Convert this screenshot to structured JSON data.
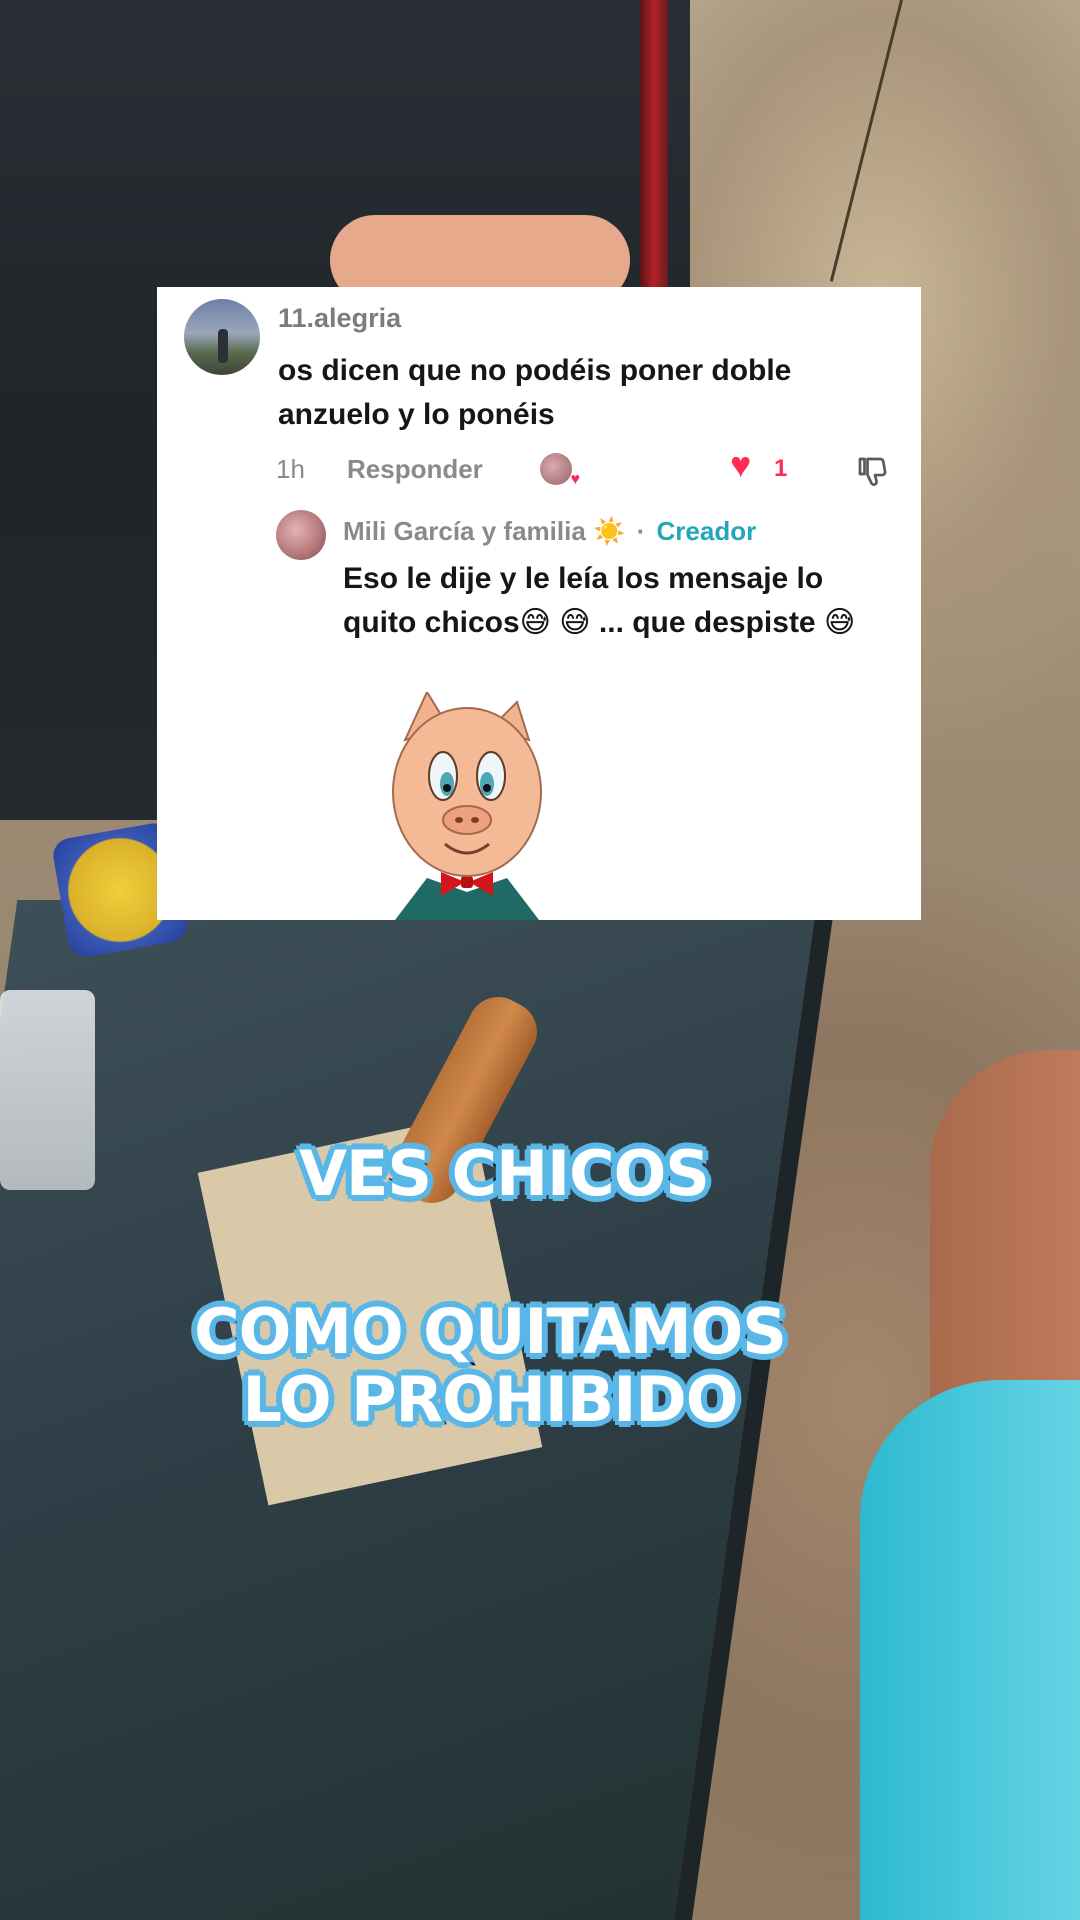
{
  "comment": {
    "username": "11.alegria",
    "text": "os dicen que no podéis poner doble anzuelo y lo ponéis",
    "time": "1h",
    "reply_label": "Responder",
    "like_count": "1"
  },
  "reply": {
    "author": "Mili García y familia",
    "author_emoji": "☀️",
    "separator": "·",
    "creator_badge": "Creador",
    "text": "Eso le dije y le leía los mensaje lo quito chicos😅 😅 ... que despiste 😅"
  },
  "caption": {
    "line1": "VES CHICOS",
    "line2": "COMO QUITAMOS",
    "line3": "LO PROHIBIDO"
  },
  "colors": {
    "like_red": "#fe2c55",
    "creator_teal": "#24a5b8",
    "caption_outline": "#59b7e8"
  },
  "icons": {
    "sticker": "pig-cartoon-sticker",
    "like": "heart-icon",
    "dislike": "thumbs-down-icon"
  }
}
